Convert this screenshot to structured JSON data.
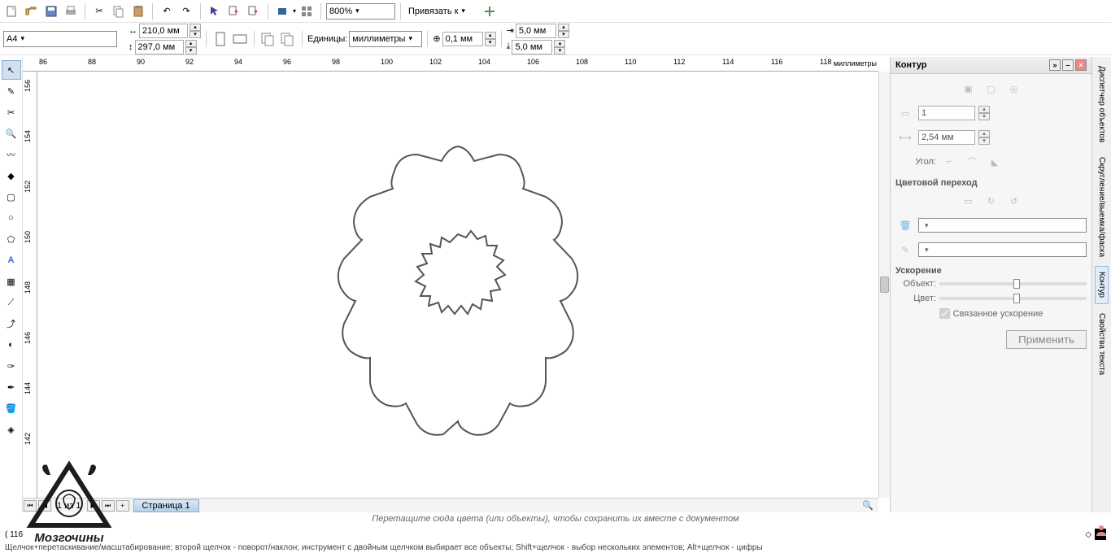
{
  "toolbar": {
    "page_format": "A4",
    "zoom": "800%",
    "snap_label": "Привязать к",
    "width": "210,0 мм",
    "height": "297,0 мм",
    "units_label": "Единицы:",
    "units_value": "миллиметры",
    "nudge": "0,1 мм",
    "dup_x": "5,0 мм",
    "dup_y": "5,0 мм"
  },
  "ruler": {
    "unit_label": "миллиметры",
    "h_ticks": [
      "86",
      "88",
      "90",
      "92",
      "94",
      "96",
      "98",
      "100",
      "102",
      "104",
      "106",
      "108",
      "110",
      "112",
      "114",
      "116",
      "118"
    ],
    "v_ticks": [
      "156",
      "154",
      "152",
      "150",
      "148",
      "146",
      "144",
      "142"
    ]
  },
  "page_nav": {
    "counter": "1 из 1",
    "tab": "Страница 1"
  },
  "hint": "Перетащите сюда цвета (или объекты), чтобы сохранить их вместе с документом",
  "status": {
    "coord": "( 116",
    "help": "Щелчок+перетаскивание/масштабирование; второй щелчок - поворот/наклон; инструмент с двойным щелчком выбирает все объекты; Shift+щелчок - выбор нескольких элементов; Alt+щелчок - цифры"
  },
  "panel": {
    "title": "Контур",
    "miter_value": "1",
    "width_value": "2,54 мм",
    "angle_label": "Угол:",
    "gradient_title": "Цветовой переход",
    "accel_title": "Ускорение",
    "object_label": "Объект:",
    "color_label": "Цвет:",
    "linked_label": "Связанное ускорение",
    "apply": "Применить"
  },
  "tabs": {
    "t1": "Диспетчер объектов",
    "t2": "Скругление/выемка/фаска",
    "t3": "Контур",
    "t4": "Свойства текста"
  },
  "swatches": [
    "none",
    "#000000",
    "#ffffff",
    "#606060",
    "#00ffff",
    "#00ff00",
    "#ffff00",
    "#ff00ff",
    "#ff0000",
    "#808000"
  ],
  "logo": "Мозгочины"
}
